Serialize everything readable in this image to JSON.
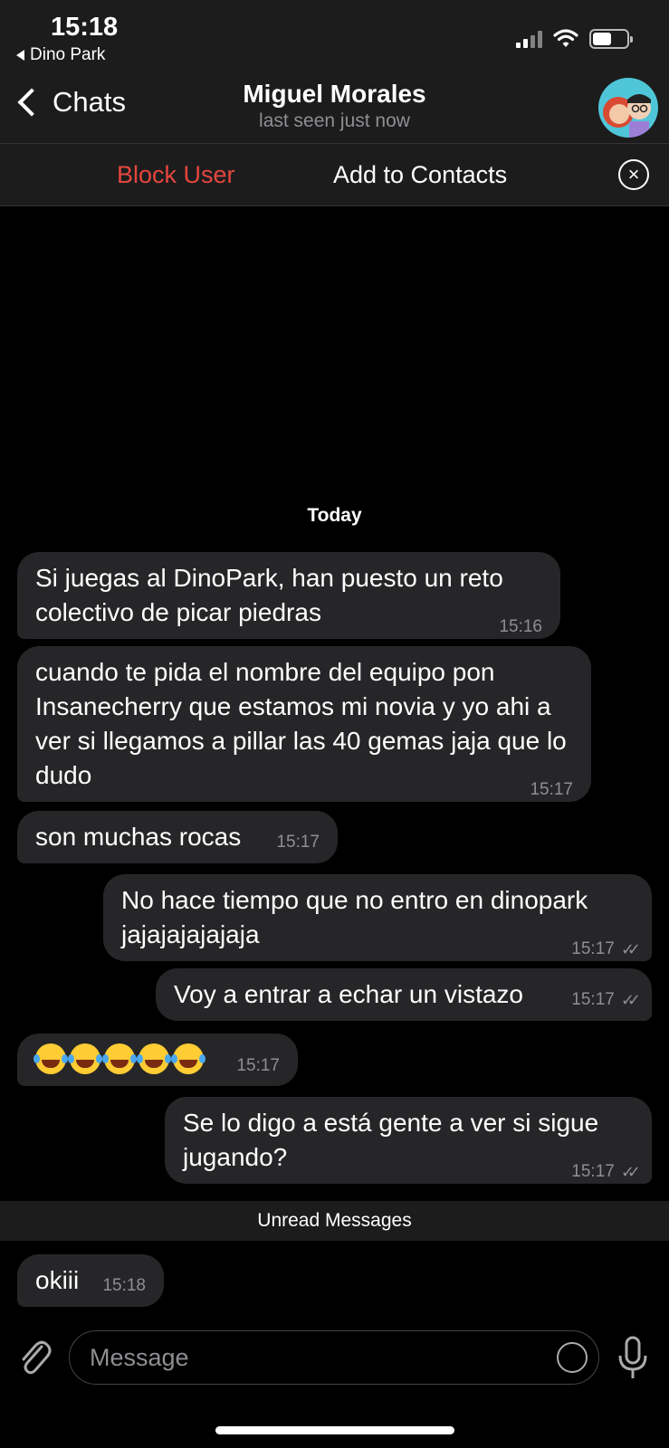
{
  "status": {
    "time": "15:18",
    "back_app": "Dino Park"
  },
  "header": {
    "back_label": "Chats",
    "contact_name": "Miguel Morales",
    "last_seen": "last seen just now"
  },
  "actions": {
    "block": "Block User",
    "add": "Add to Contacts"
  },
  "date_label": "Today",
  "messages": [
    {
      "dir": "in",
      "text": "Si juegas al DinoPark, han puesto un reto colectivo de picar piedras",
      "time": "15:16"
    },
    {
      "dir": "in",
      "text": "cuando te pida el nombre del equipo pon Insanecherry que estamos mi novia y yo ahi a ver si llegamos a pillar las 40 gemas jaja que lo dudo",
      "time": "15:17"
    },
    {
      "dir": "in",
      "text": "son muchas rocas",
      "time": "15:17"
    },
    {
      "dir": "out",
      "text": "No hace tiempo que no entro en dinopark jajajajajajaja",
      "time": "15:17"
    },
    {
      "dir": "out",
      "text": "Voy a entrar a echar un vistazo",
      "time": "15:17"
    },
    {
      "dir": "in",
      "text": "😂😂😂😂😂",
      "time": "15:17"
    },
    {
      "dir": "out",
      "text": "Se lo digo a está gente a ver si sigue jugando?",
      "time": "15:17"
    },
    {
      "dir": "in",
      "text": "okiii",
      "time": "15:18"
    }
  ],
  "unread_label": "Unread Messages",
  "input": {
    "placeholder": "Message"
  },
  "colors": {
    "background": "#000000",
    "bubble": "#262628",
    "header": "#1c1c1d",
    "block_red": "#e5463f",
    "meta_gray": "#8e8e93"
  }
}
